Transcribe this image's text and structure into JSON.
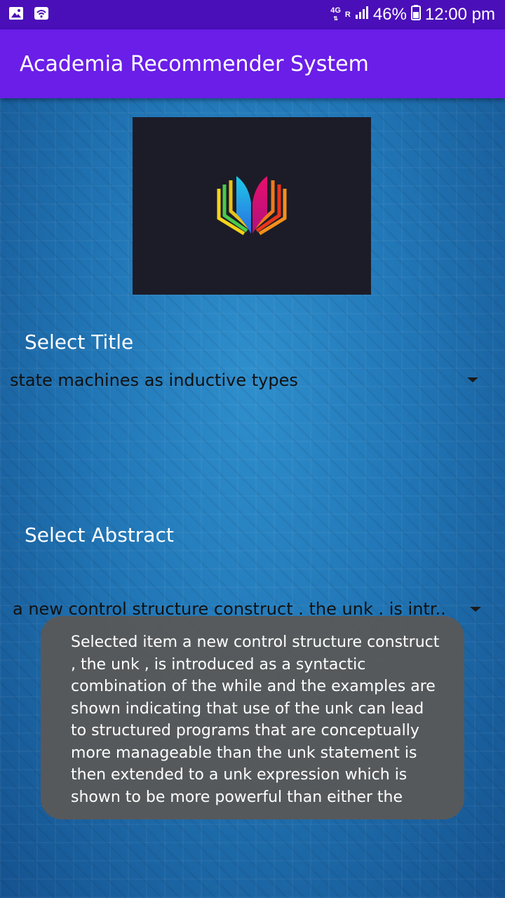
{
  "status_bar": {
    "network_type": "4G",
    "roaming": "R",
    "battery": "46%",
    "time": "12:00 pm",
    "icons": [
      "gallery-icon",
      "wifi-icon",
      "signal-icon",
      "battery-icon"
    ]
  },
  "app_bar": {
    "title": "Academia Recommender System"
  },
  "logo": {
    "icon": "open-book-logo"
  },
  "title_section": {
    "label": "Select Title",
    "selected_value": "state machines as inductive types"
  },
  "abstract_section": {
    "label": "Select Abstract",
    "selected_value": "a new control structure construct . the unk . is intr.."
  },
  "toast": {
    "message": "Selected item a new control structure construct , the unk , is introduced as a syntactic combination of the while and the examples are shown indicating that use of the unk can lead to structured programs that are conceptually more manageable than the unk statement is then extended to a unk expression which is shown to be more powerful than either the"
  },
  "colors": {
    "status_bar": "#4a0fb8",
    "app_bar": "#6a1ee8",
    "background": "#2176b6",
    "toast": "#585858"
  }
}
